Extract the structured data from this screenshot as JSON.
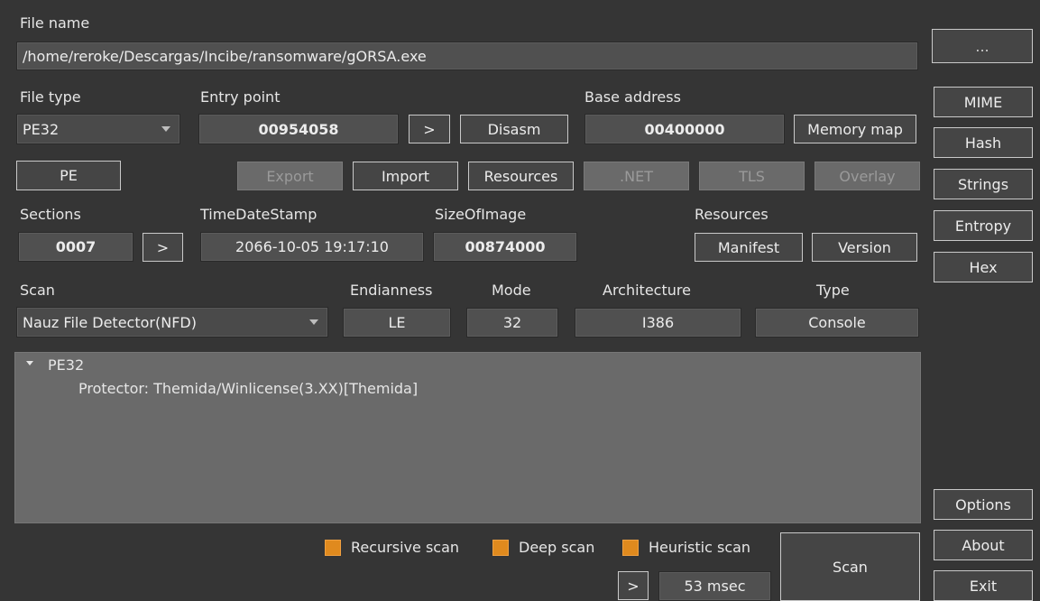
{
  "file": {
    "label": "File name",
    "path": "/home/reroke/Descargas/Incibe/ransomware/gORSA.exe",
    "browse_label": "..."
  },
  "file_type": {
    "label": "File type",
    "value": "PE32"
  },
  "entry_point": {
    "label": "Entry point",
    "value": "00954058",
    "go_label": ">",
    "disasm_label": "Disasm"
  },
  "base_address": {
    "label": "Base address",
    "value": "00400000",
    "memory_map_label": "Memory map"
  },
  "pe_buttons": {
    "pe": "PE",
    "export": "Export",
    "import": "Import",
    "resources": "Resources",
    "net": ".NET",
    "tls": "TLS",
    "overlay": "Overlay"
  },
  "sections": {
    "label": "Sections",
    "value": "0007",
    "go_label": ">"
  },
  "timedatestamp": {
    "label": "TimeDateStamp",
    "value": "2066-10-05 19:17:10"
  },
  "size_of_image": {
    "label": "SizeOfImage",
    "value": "00874000"
  },
  "resources": {
    "label": "Resources",
    "manifest_label": "Manifest",
    "version_label": "Version"
  },
  "scan": {
    "label": "Scan",
    "engine": "Nauz File Detector(NFD)"
  },
  "endianness": {
    "label": "Endianness",
    "value": "LE"
  },
  "mode": {
    "label": "Mode",
    "value": "32"
  },
  "architecture": {
    "label": "Architecture",
    "value": "I386"
  },
  "type": {
    "label": "Type",
    "value": "Console"
  },
  "results": {
    "root": "PE32",
    "items": [
      "Protector: Themida/Winlicense(3.XX)[Themida]"
    ]
  },
  "options": {
    "recursive_label": "Recursive scan",
    "deep_label": "Deep scan",
    "heuristic_label": "Heuristic scan"
  },
  "scan_button_label": "Scan",
  "log_go_label": ">",
  "elapsed": "53 msec",
  "sidebar": {
    "mime": "MIME",
    "hash": "Hash",
    "strings": "Strings",
    "entropy": "Entropy",
    "hex": "Hex",
    "options": "Options",
    "about": "About",
    "exit": "Exit"
  },
  "colors": {
    "background": "#353535",
    "checkbox": "#e08a1e"
  }
}
